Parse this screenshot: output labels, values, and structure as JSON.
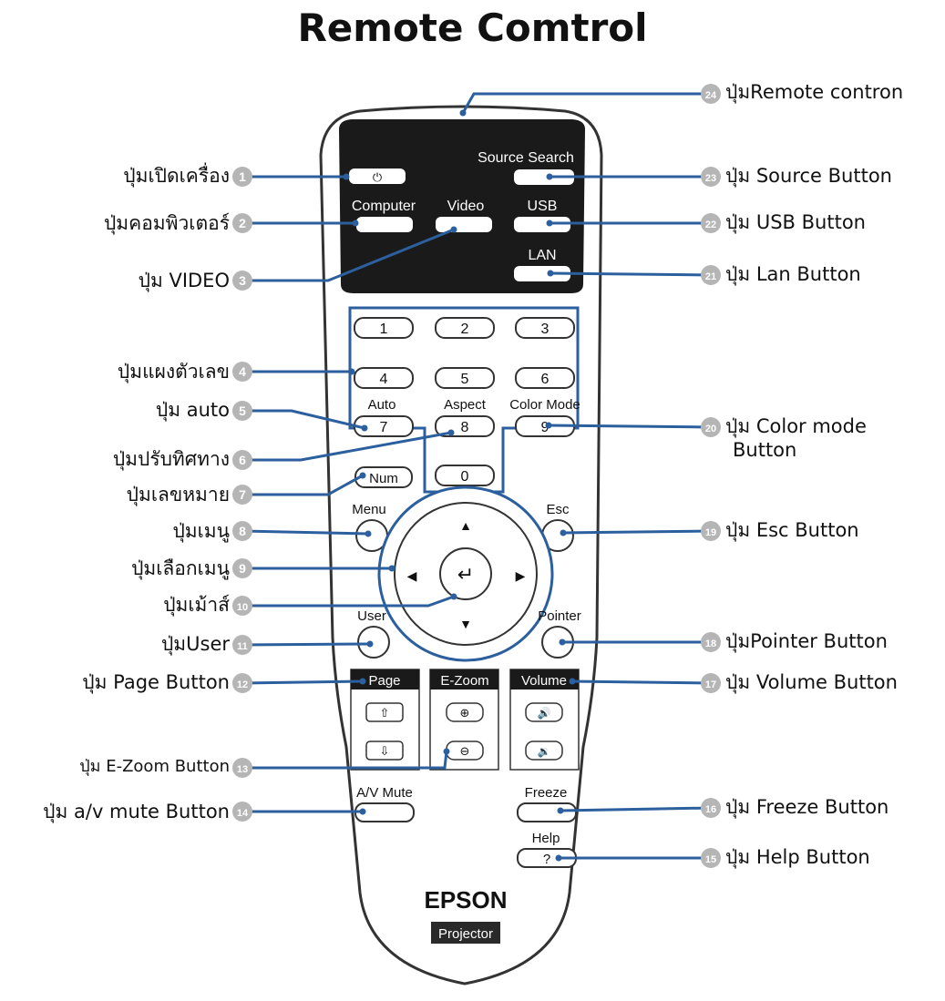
{
  "title": "Remote Comtrol",
  "remote": {
    "brand": "EPSON",
    "badge": "Projector",
    "buttons": {
      "source_search": "Source Search",
      "computer": "Computer",
      "video": "Video",
      "usb": "USB",
      "lan": "LAN",
      "auto": "Auto",
      "aspect": "Aspect",
      "color_mode": "Color Mode",
      "num": "Num",
      "menu": "Menu",
      "esc": "Esc",
      "user": "User",
      "pointer": "Pointer",
      "page": "Page",
      "ezoom": "E-Zoom",
      "volume": "Volume",
      "av_mute": "A/V Mute",
      "freeze": "Freeze",
      "help": "Help",
      "help_key": "?",
      "digits": [
        "1",
        "2",
        "3",
        "4",
        "5",
        "6",
        "7",
        "8",
        "9",
        "0"
      ]
    }
  },
  "callouts": [
    {
      "n": "1",
      "text": "ปุ่มเปิดเครื่อง"
    },
    {
      "n": "2",
      "text": "ปุ่มคอมพิวเตอร์"
    },
    {
      "n": "3",
      "text": "ปุ่ม VIDEO"
    },
    {
      "n": "4",
      "text": "ปุ่มแผงตัวเลข"
    },
    {
      "n": "5",
      "text": "ปุ่ม auto"
    },
    {
      "n": "6",
      "text": "ปุ่มปรับทิศทาง"
    },
    {
      "n": "7",
      "text": "ปุ่มเลขหมาย"
    },
    {
      "n": "8",
      "text": "ปุ่มเมนู"
    },
    {
      "n": "9",
      "text": "ปุ่มเลือกเมนู"
    },
    {
      "n": "10",
      "text": "ปุ่มเม้าส์"
    },
    {
      "n": "11",
      "text": "ปุ่มUser"
    },
    {
      "n": "12",
      "text": "ปุ่ม Page Button"
    },
    {
      "n": "13",
      "text": "ปุ่ม E-Zoom Button"
    },
    {
      "n": "14",
      "text": "ปุ่ม a/v mute Button"
    },
    {
      "n": "15",
      "text": "ปุ่ม Help Button"
    },
    {
      "n": "16",
      "text": "ปุ่ม Freeze Button"
    },
    {
      "n": "17",
      "text": "ปุ่ม Volume Button"
    },
    {
      "n": "18",
      "text": "ปุ่มPointer Button"
    },
    {
      "n": "19",
      "text": "ปุ่ม Esc Button"
    },
    {
      "n": "20",
      "text": "ปุ่ม Color mode\nButton"
    },
    {
      "n": "21",
      "text": "ปุ่ม Lan Button"
    },
    {
      "n": "22",
      "text": "ปุ่ม USB Button"
    },
    {
      "n": "23",
      "text": "ปุ่ม Source Button"
    },
    {
      "n": "24",
      "text": "ปุ่มRemote contron"
    }
  ],
  "colors": {
    "leader": "#2c5f9e",
    "badge": "#b5b5b5",
    "panel": "#1a1a1a",
    "outline": "#333333"
  }
}
